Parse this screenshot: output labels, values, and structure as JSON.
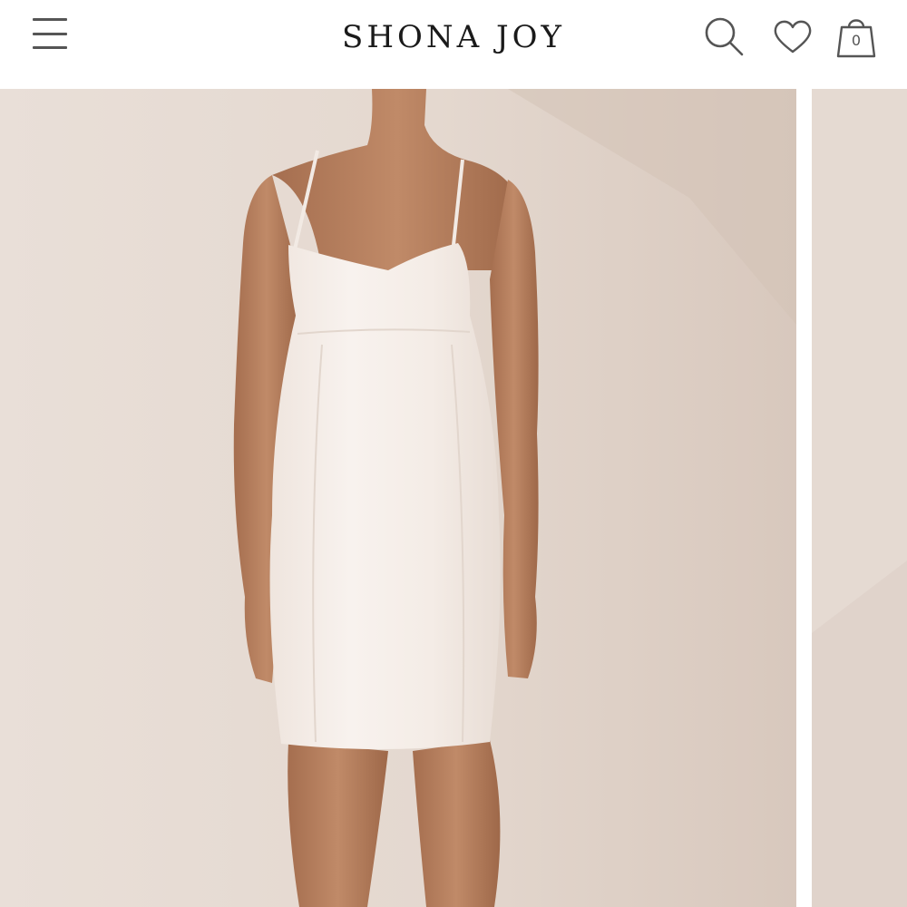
{
  "header": {
    "logo_text": "SHONA JOY",
    "icons": [
      "menu-icon",
      "search-icon",
      "heart-icon",
      "shopping-bag-icon"
    ],
    "cart_count": "0"
  },
  "gallery": {
    "slides_visible": 2,
    "colors": {
      "backdrop": "#e6dbd3",
      "dress": "#f4ece6",
      "skin": "#b98260"
    }
  }
}
